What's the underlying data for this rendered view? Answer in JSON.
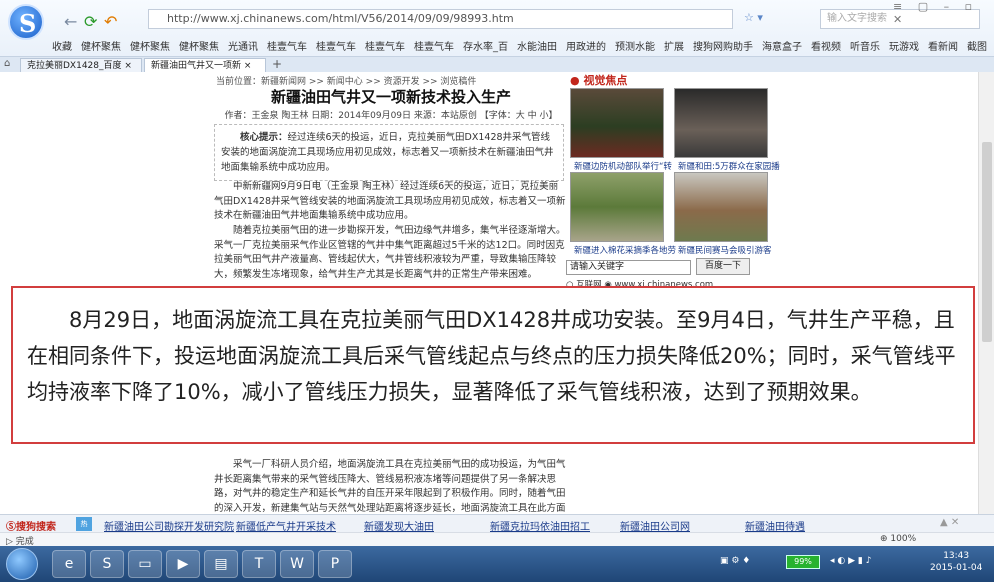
{
  "browser": {
    "address_url": "http://www.xj.chinanews.com/html/V56/2014/09/09/98993.htm",
    "search_placeholder": "输入文字搜索",
    "favorites": [
      "收藏",
      "健杯聚焦",
      "健杯聚焦",
      "健杯聚焦",
      "光通讯",
      "桂壹气车",
      "桂壹气车",
      "桂壹气车",
      "桂壹气车",
      "存水率_百",
      "水能油田",
      "用政进的",
      "预测水能",
      "扩展",
      "搜狗网购助手",
      "海意盒子",
      "看视频",
      "听音乐",
      "玩游戏",
      "看新闻",
      "截图"
    ],
    "tabs": [
      "克拉美丽DX1428_百度",
      "新疆油田气井又一项新"
    ]
  },
  "article": {
    "breadcrumb": "当前位置：新疆新闻网 >> 新闻中心 >> 资源开发 >> 浏览稿件",
    "title": "新疆油田气井又一项新技术投入生产",
    "meta": "作者：王金泉 陶王林  日期：2014年09月09日  来源：本站原创   【字体：大 中 小】",
    "summary_label": "核心提示：",
    "summary": "经过连续6天的投运，近日，克拉美丽气田DX1428井采气管线安装的地面涡旋流工具现场应用初见成效，标志着又一项新技术在新疆油田气井地面集输系统中成功应用。",
    "para1": "中新新疆网9月9日电（王金泉 陶王林）经过连续6天的投运，近日，克拉美丽气田DX1428井采气管线安装的地面涡旋流工具现场应用初见成效，标志着又一项新技术在新疆油田气井地面集输系统中成功应用。",
    "para2": "随着克拉美丽气田的进一步勘探开发，气田边缘气井增多，集气半径逐渐增大。采气一厂克拉美丽采气作业区管辖的气井中集气距离超过5千米的达12口。同时因克拉美丽气田气井产液量高、管线起伏大，气井管线积液较为严重，导致集输压降较大，频繁发生冻堵现象，给气井生产尤其是长距离气井的正常生产带来困难。",
    "para3": "采气一厂科研人员介绍，地面涡旋流工具在克拉美丽气田的成功投运，为气田气井长距离集气带来的采气管线压降大、管线易积液冻堵等问题提供了另一条解决思路，对气井的稳定生产和延长气井的自压开采年限起到了积极作用。同时，随着气田的深入开发，新建集气站与天然气处理站距离将逐步延长，地面涡旋流工具在此方面应用将有望进行推广。",
    "zoom_text": "8月29日，地面涡旋流工具在克拉美丽气田DX1428井成功安装。至9月4日，气井生产平稳，且在相同条件下，投运地面涡旋流工具后采气管线起点与终点的压力损失降低20%；同时，采气管线平均持液率下降了10%，减小了管线压力损失，显著降低了采气管线积液，达到了预期效果。"
  },
  "sidebar": {
    "title": "视觉焦点",
    "captions": [
      "新疆边防机动部队举行“转",
      "新疆和田:5万群众在家园播",
      "新疆进入棉花采摘季各地劳",
      "新疆民间赛马会吸引游客"
    ],
    "search_placeholder": "请输入关键字",
    "search_button": "百度一下",
    "radio_web": "互联网",
    "radio_site": "www.xj.chinanews.com"
  },
  "assistbar": {
    "label": "搜狗搜索",
    "links": [
      "新疆油田公司勘探开发研究院",
      "新疆低产气井开采技术",
      "新疆发现大油田",
      "新疆克拉玛依油田招工",
      "新疆油田公司网",
      "新疆油田待遇"
    ]
  },
  "statusbar": {
    "text": "完成",
    "zoom": "100%"
  },
  "taskbar": {
    "battery": "99%",
    "time": "13:43",
    "date": "2015-01-04"
  }
}
